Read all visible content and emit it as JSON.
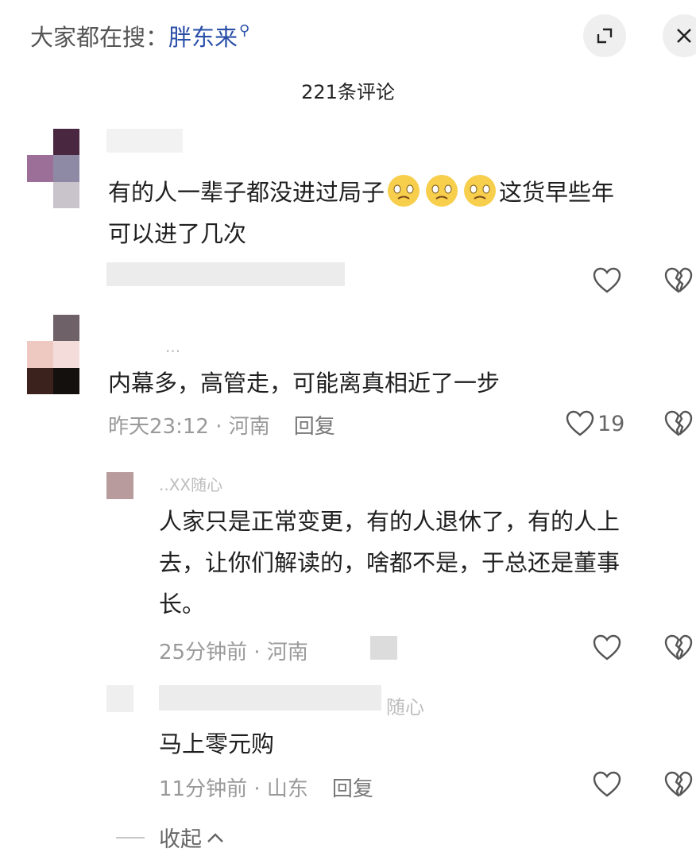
{
  "header": {
    "search_prefix": "大家都在搜：",
    "search_keyword": "胖东来",
    "comment_count": "221条评论"
  },
  "comments": [
    {
      "text_line1": "有的人一辈子都没进过局子",
      "text_line1_tail": "这货早些年",
      "text_line2": "可以进了几次"
    },
    {
      "username_fragment": "...",
      "text": "内幕多，高管走，可能离真相近了一步",
      "time": "昨天23:12",
      "location": "河南",
      "reply_label": "回复",
      "likes": "19"
    }
  ],
  "replies": [
    {
      "username_fragment": "..XX随心",
      "text_line1": "人家只是正常变更，有的人退休了，有的人上",
      "text_line2": "去，让你们解读的，啥都不是，于总还是董事",
      "text_line3": "长。",
      "time": "25分钟前",
      "location": "河南"
    },
    {
      "username_fragment": "随心",
      "text": "马上零元购",
      "time": "11分钟前",
      "location": "山东",
      "reply_label": "回复"
    }
  ],
  "footer": {
    "collapse_label": "收起"
  },
  "colors": {
    "keyword": "#2a4fa8",
    "meta": "#9a9a9a"
  }
}
